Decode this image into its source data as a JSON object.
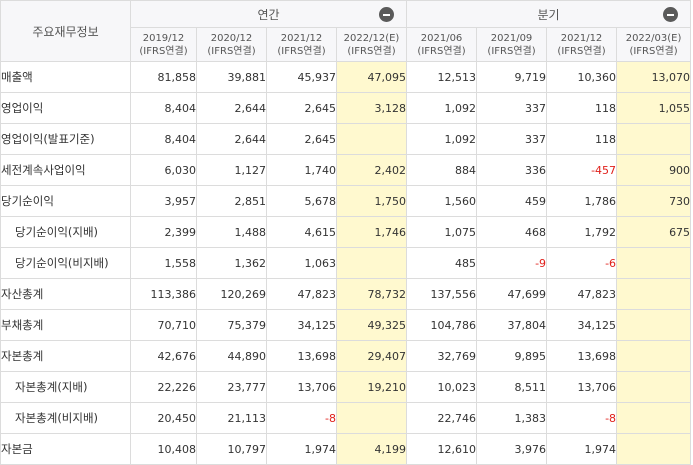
{
  "header": {
    "corner": "주요재무정보",
    "annual": "연간",
    "quarterly": "분기",
    "collapse_icon": "minus-circle-icon",
    "periods": [
      {
        "date": "2019/12",
        "basis": "(IFRS연결)"
      },
      {
        "date": "2020/12",
        "basis": "(IFRS연결)"
      },
      {
        "date": "2021/12",
        "basis": "(IFRS연결)"
      },
      {
        "date": "2022/12(E)",
        "basis": "(IFRS연결)"
      },
      {
        "date": "2021/06",
        "basis": "(IFRS연결)"
      },
      {
        "date": "2021/09",
        "basis": "(IFRS연결)"
      },
      {
        "date": "2021/12",
        "basis": "(IFRS연결)"
      },
      {
        "date": "2022/03(E)",
        "basis": "(IFRS연결)"
      }
    ]
  },
  "colors": {
    "estimate_bg": "#fff9cf",
    "negative": "#e0201b"
  },
  "rows": [
    {
      "label": "매출액",
      "sub": false,
      "values": [
        "81,858",
        "39,881",
        "45,937",
        "47,095",
        "12,513",
        "9,719",
        "10,360",
        "13,070"
      ]
    },
    {
      "label": "영업이익",
      "sub": false,
      "values": [
        "8,404",
        "2,644",
        "2,645",
        "3,128",
        "1,092",
        "337",
        "118",
        "1,055"
      ]
    },
    {
      "label": "영업이익(발표기준)",
      "sub": false,
      "values": [
        "8,404",
        "2,644",
        "2,645",
        "",
        "1,092",
        "337",
        "118",
        ""
      ]
    },
    {
      "label": "세전계속사업이익",
      "sub": false,
      "values": [
        "6,030",
        "1,127",
        "1,740",
        "2,402",
        "884",
        "336",
        "-457",
        "900"
      ]
    },
    {
      "label": "당기순이익",
      "sub": false,
      "values": [
        "3,957",
        "2,851",
        "5,678",
        "1,750",
        "1,560",
        "459",
        "1,786",
        "730"
      ]
    },
    {
      "label": "당기순이익(지배)",
      "sub": true,
      "values": [
        "2,399",
        "1,488",
        "4,615",
        "1,746",
        "1,075",
        "468",
        "1,792",
        "675"
      ]
    },
    {
      "label": "당기순이익(비지배)",
      "sub": true,
      "values": [
        "1,558",
        "1,362",
        "1,063",
        "",
        "485",
        "-9",
        "-6",
        ""
      ]
    },
    {
      "label": "자산총계",
      "sub": false,
      "values": [
        "113,386",
        "120,269",
        "47,823",
        "78,732",
        "137,556",
        "47,699",
        "47,823",
        ""
      ]
    },
    {
      "label": "부채총계",
      "sub": false,
      "values": [
        "70,710",
        "75,379",
        "34,125",
        "49,325",
        "104,786",
        "37,804",
        "34,125",
        ""
      ]
    },
    {
      "label": "자본총계",
      "sub": false,
      "values": [
        "42,676",
        "44,890",
        "13,698",
        "29,407",
        "32,769",
        "9,895",
        "13,698",
        ""
      ]
    },
    {
      "label": "자본총계(지배)",
      "sub": true,
      "values": [
        "22,226",
        "23,777",
        "13,706",
        "19,210",
        "10,023",
        "8,511",
        "13,706",
        ""
      ]
    },
    {
      "label": "자본총계(비지배)",
      "sub": true,
      "values": [
        "20,450",
        "21,113",
        "-8",
        "",
        "22,746",
        "1,383",
        "-8",
        ""
      ]
    },
    {
      "label": "자본금",
      "sub": false,
      "values": [
        "10,408",
        "10,797",
        "1,974",
        "4,199",
        "12,610",
        "3,976",
        "1,974",
        ""
      ]
    }
  ]
}
